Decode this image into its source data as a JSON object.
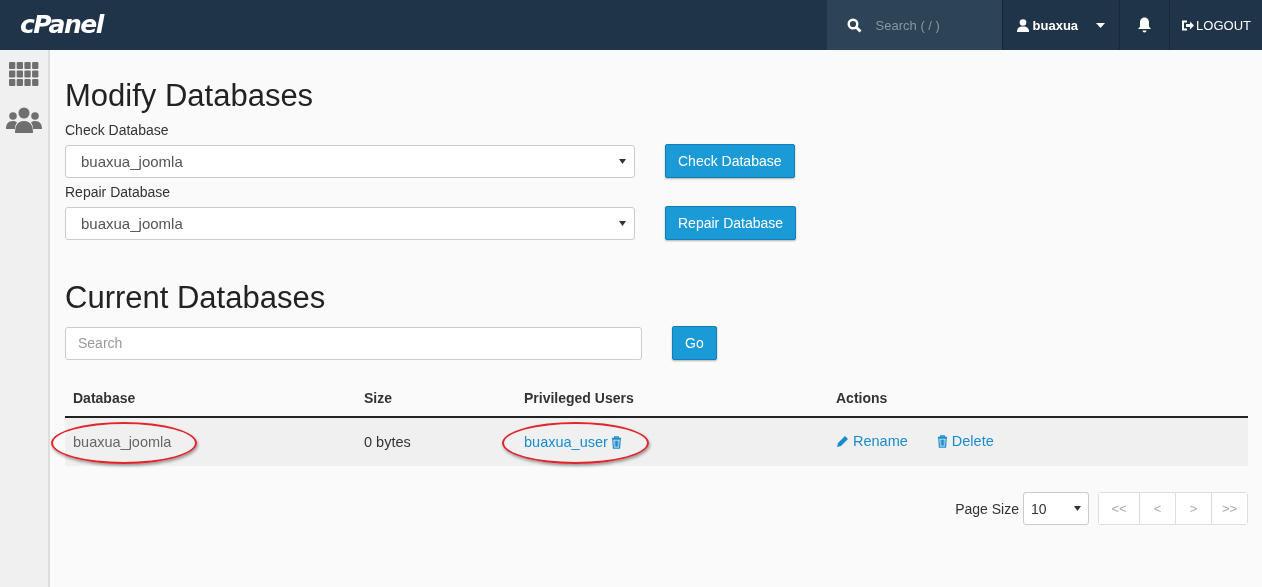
{
  "topbar": {
    "logo": "cPanel",
    "search": {
      "placeholder": "Search ( / )"
    },
    "user": "buaxua",
    "logout": "LOGOUT"
  },
  "modify": {
    "title": "Modify Databases",
    "forms": [
      {
        "label": "Check Database",
        "value": "buaxua_joomla",
        "button": "Check Database"
      },
      {
        "label": "Repair Database",
        "value": "buaxua_joomla",
        "button": "Repair Database"
      }
    ]
  },
  "current": {
    "title": "Current Databases",
    "search": {
      "placeholder": "Search"
    },
    "go": "Go",
    "table": {
      "columns": [
        "Database",
        "Size",
        "Privileged Users",
        "Actions"
      ],
      "rows": [
        {
          "database": "buaxua_joomla",
          "database_circled": true,
          "size": "0 bytes",
          "user": "buaxua_user",
          "user_circled": true,
          "actions": [
            {
              "kind": "rename",
              "label": "Rename"
            },
            {
              "kind": "delete",
              "label": "Delete"
            }
          ]
        }
      ]
    }
  },
  "pagination": {
    "page_size_label": "Page Size",
    "page_size": "10",
    "buttons": [
      {
        "label": "<<",
        "disabled": true
      },
      {
        "label": "<",
        "disabled": true
      },
      {
        "label": ">",
        "disabled": true
      },
      {
        "label": ">>",
        "disabled": true
      }
    ]
  }
}
